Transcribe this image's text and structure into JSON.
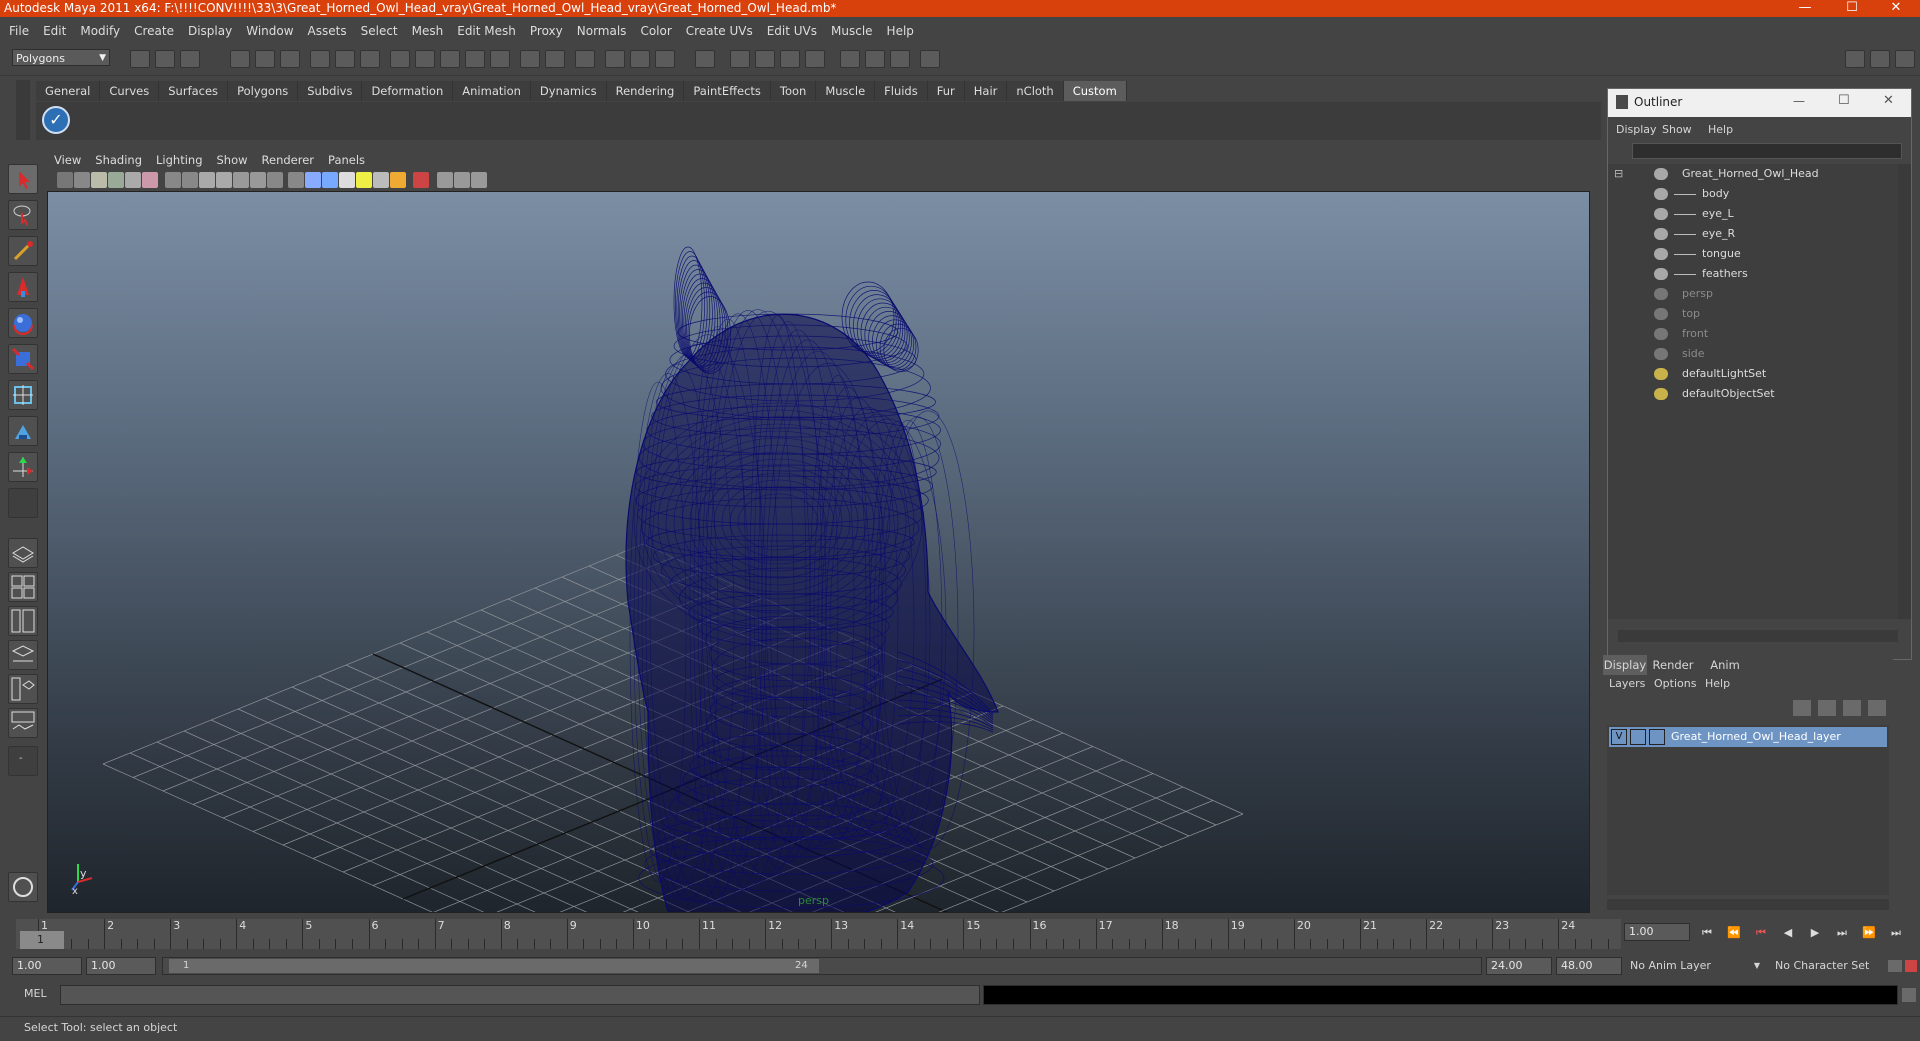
{
  "window": {
    "title": "Autodesk Maya 2011 x64: F:\\!!!!CONV!!!!\\33\\3\\Great_Horned_Owl_Head_vray\\Great_Horned_Owl_Head_vray\\Great_Horned_Owl_Head.mb*",
    "minimize": "—",
    "maximize": "☐",
    "close": "✕"
  },
  "menubar": [
    "File",
    "Edit",
    "Modify",
    "Create",
    "Display",
    "Window",
    "Assets",
    "Select",
    "Mesh",
    "Edit Mesh",
    "Proxy",
    "Normals",
    "Color",
    "Create UVs",
    "Edit UVs",
    "Muscle",
    "Help"
  ],
  "statusline": {
    "mode": "Polygons"
  },
  "shelf": {
    "tabs": [
      "General",
      "Curves",
      "Surfaces",
      "Polygons",
      "Subdivs",
      "Deformation",
      "Animation",
      "Dynamics",
      "Rendering",
      "PaintEffects",
      "Toon",
      "Muscle",
      "Fluids",
      "Fur",
      "Hair",
      "nCloth",
      "Custom"
    ],
    "active_tab": "Custom"
  },
  "viewport": {
    "menus": [
      "View",
      "Shading",
      "Lighting",
      "Show",
      "Renderer",
      "Panels"
    ],
    "camera_label": "persp",
    "axis_y": "y",
    "axis_x": "x",
    "wire_color": "#0a0a6e"
  },
  "outliner": {
    "title": "Outliner",
    "menus": [
      "Display",
      "Show",
      "Help"
    ],
    "items": [
      {
        "label": "Great_Horned_Owl_Head",
        "indent": 0,
        "dim": false,
        "expand": "⊟"
      },
      {
        "label": "body",
        "indent": 1,
        "dim": false
      },
      {
        "label": "eye_L",
        "indent": 1,
        "dim": false
      },
      {
        "label": "eye_R",
        "indent": 1,
        "dim": false
      },
      {
        "label": "tongue",
        "indent": 1,
        "dim": false
      },
      {
        "label": "feathers",
        "indent": 1,
        "dim": false
      },
      {
        "label": "persp",
        "indent": 0,
        "dim": true
      },
      {
        "label": "top",
        "indent": 0,
        "dim": true
      },
      {
        "label": "front",
        "indent": 0,
        "dim": true
      },
      {
        "label": "side",
        "indent": 0,
        "dim": true
      },
      {
        "label": "defaultLightSet",
        "indent": 0,
        "dim": false
      },
      {
        "label": "defaultObjectSet",
        "indent": 0,
        "dim": false
      }
    ]
  },
  "layers": {
    "tabs": [
      "Display",
      "Render",
      "Anim"
    ],
    "active_tab": "Display",
    "menus": [
      "Layers",
      "Options",
      "Help"
    ],
    "items": [
      {
        "visible": "V",
        "name": "Great_Horned_Owl_Head_layer"
      }
    ]
  },
  "timeline": {
    "ticks": [
      "1",
      "2",
      "3",
      "4",
      "5",
      "6",
      "7",
      "8",
      "9",
      "10",
      "11",
      "12",
      "13",
      "14",
      "15",
      "16",
      "17",
      "18",
      "19",
      "20",
      "21",
      "22",
      "23",
      "24"
    ],
    "current_frame": "1.00",
    "current_marker": "1"
  },
  "range": {
    "start": "1.00",
    "playback_start": "1.00",
    "slider_start": "1",
    "slider_end": "24",
    "playback_end": "24.00",
    "end": "48.00",
    "anim_layer": "No Anim Layer",
    "character_set": "No Character Set"
  },
  "mel": {
    "label": "MEL"
  },
  "helpline": {
    "text": "Select Tool: select an object"
  }
}
